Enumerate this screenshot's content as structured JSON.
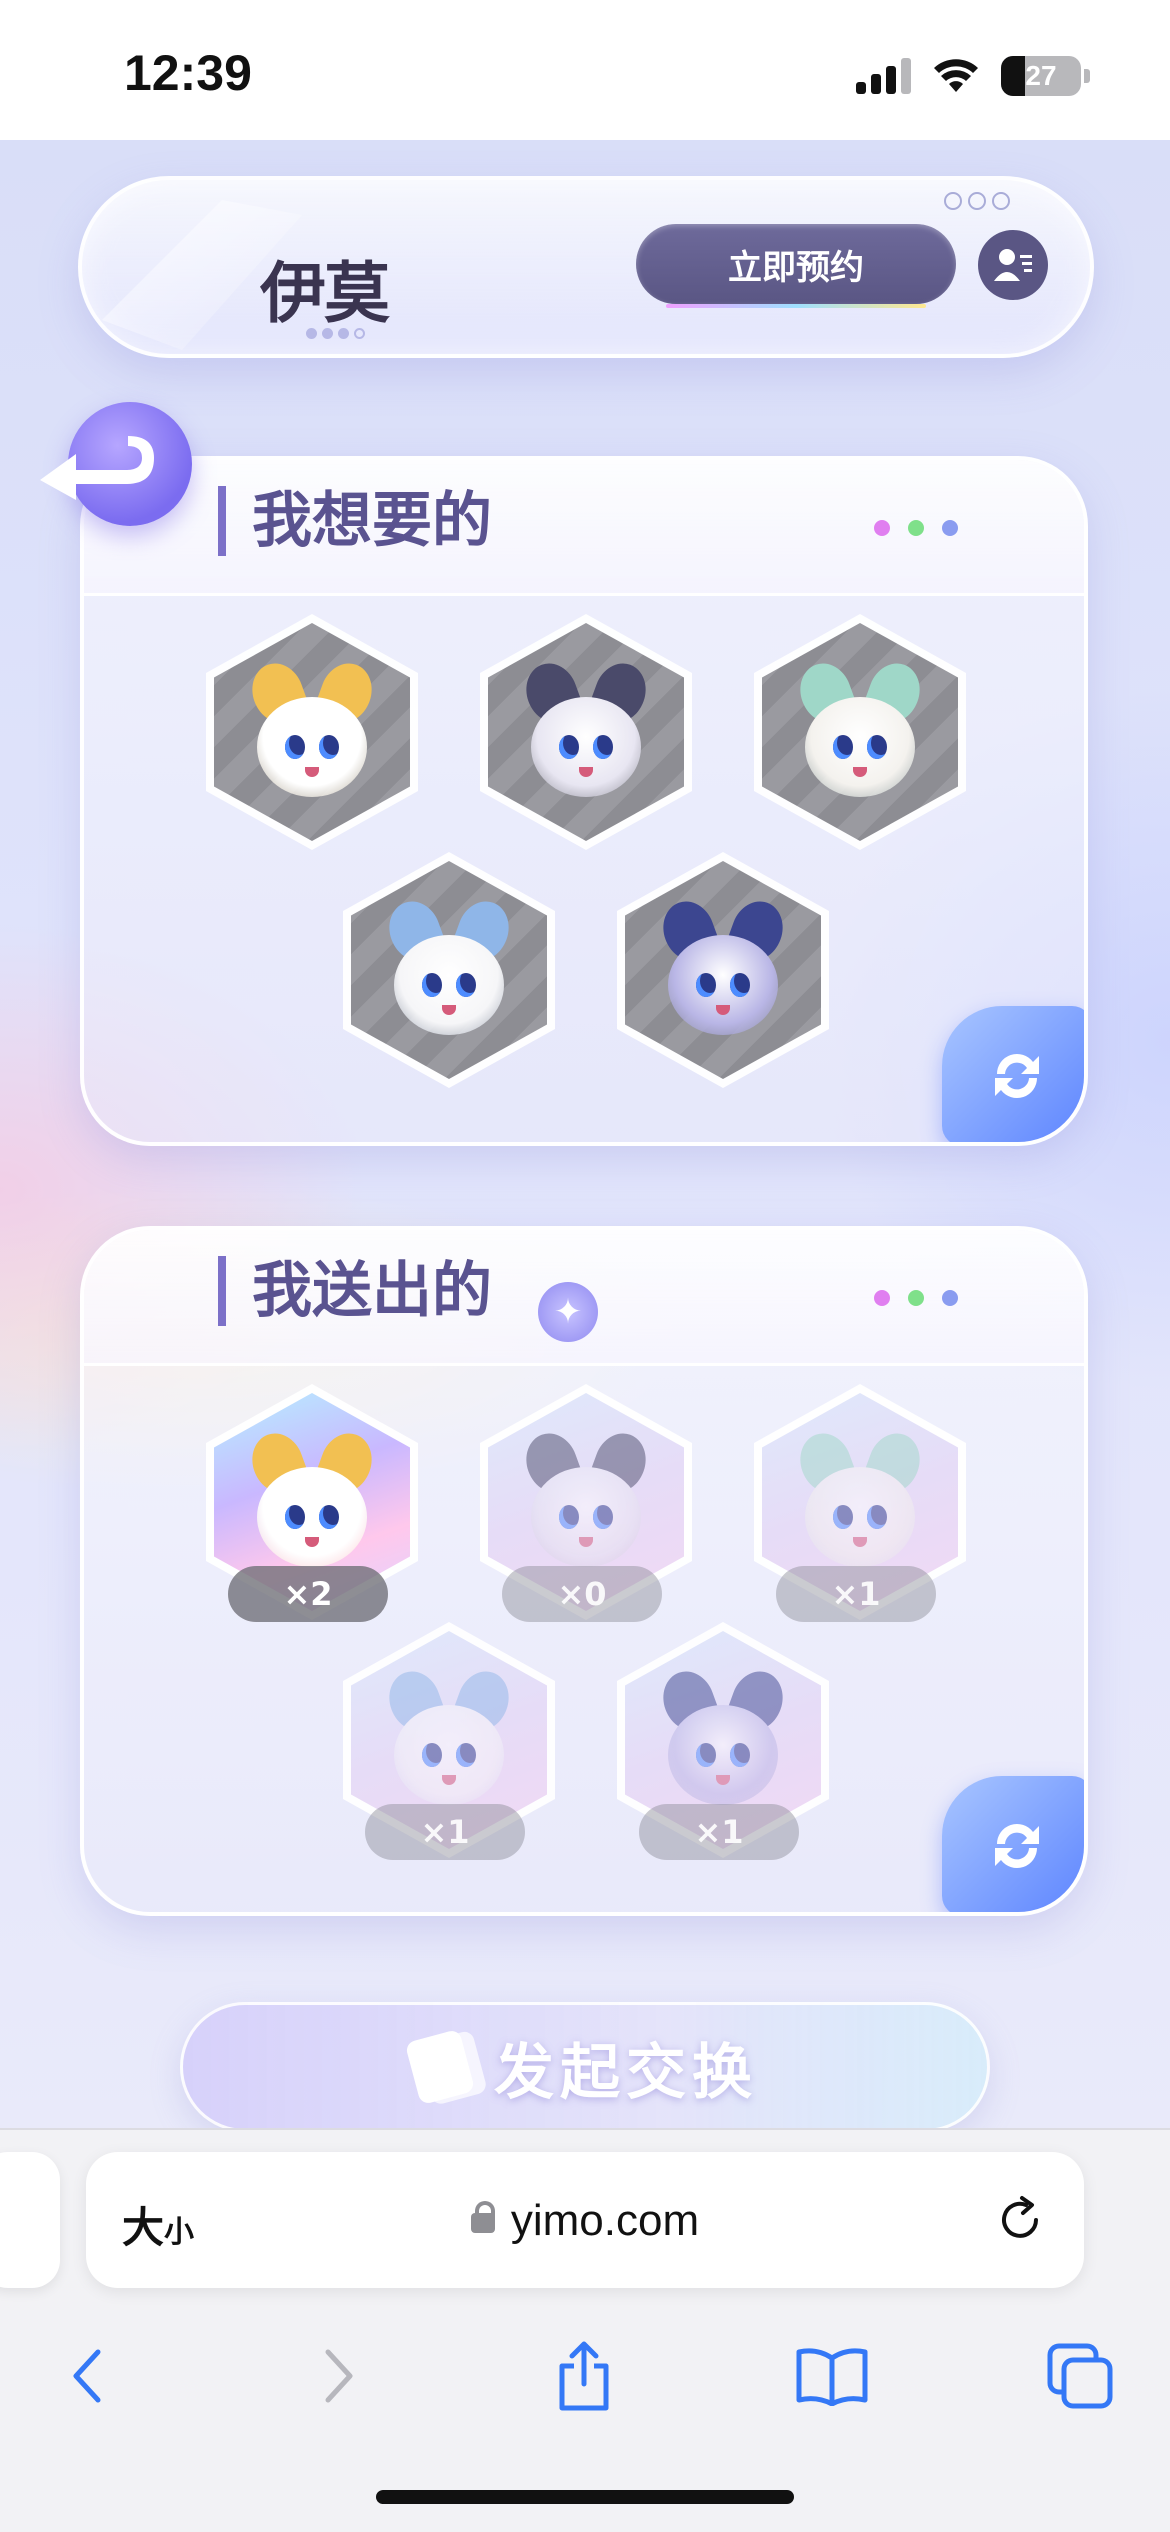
{
  "status_bar": {
    "time": "12:39",
    "battery_percent": "27"
  },
  "header": {
    "logo_text": "伊莫",
    "reserve_button": "立即预约"
  },
  "wanted_section": {
    "title": "我想要的",
    "dot_colors": [
      "#e07ff0",
      "#7fe08a",
      "#8a9cf0"
    ],
    "creatures": [
      {
        "name": "golden-fox-creature",
        "color": "#ffffff",
        "accent": "#f2c052"
      },
      {
        "name": "dark-fox-creature",
        "color": "#e8e6f2",
        "accent": "#4a4a6a"
      },
      {
        "name": "sheep-creature",
        "color": "#f4f2ee",
        "accent": "#9fd7c8"
      },
      {
        "name": "white-otter-creature",
        "color": "#f6f6f8",
        "accent": "#8fb6e8"
      },
      {
        "name": "star-mouse-creature",
        "color": "#b9b6e6",
        "accent": "#3c4690"
      }
    ]
  },
  "given_section": {
    "title": "我送出的",
    "sparkle_icon": "sparkle-icon",
    "dot_colors": [
      "#e07ff0",
      "#7fe08a",
      "#8a9cf0"
    ],
    "items": [
      {
        "name": "golden-fox-creature",
        "count": "×2",
        "active": true,
        "color": "#ffffff",
        "accent": "#f2c052"
      },
      {
        "name": "dark-fox-creature",
        "count": "×0",
        "active": false,
        "color": "#e8e6f2",
        "accent": "#4a4a6a"
      },
      {
        "name": "sheep-creature",
        "count": "×1",
        "active": false,
        "color": "#f4f2ee",
        "accent": "#9fd7c8"
      },
      {
        "name": "white-otter-creature",
        "count": "×1",
        "active": false,
        "color": "#f6f6f8",
        "accent": "#8fb6e8"
      },
      {
        "name": "star-mouse-creature",
        "count": "×1",
        "active": false,
        "color": "#b9b6e6",
        "accent": "#3c4690"
      }
    ]
  },
  "exchange_button": "发起交换",
  "browser": {
    "text_size_label": "大",
    "text_size_small": "小",
    "url": "yimo.com"
  },
  "colors": {
    "accent_purple": "#5a5390",
    "button_dark": "#5a5684",
    "refresh_blue": "#5b83ff"
  }
}
